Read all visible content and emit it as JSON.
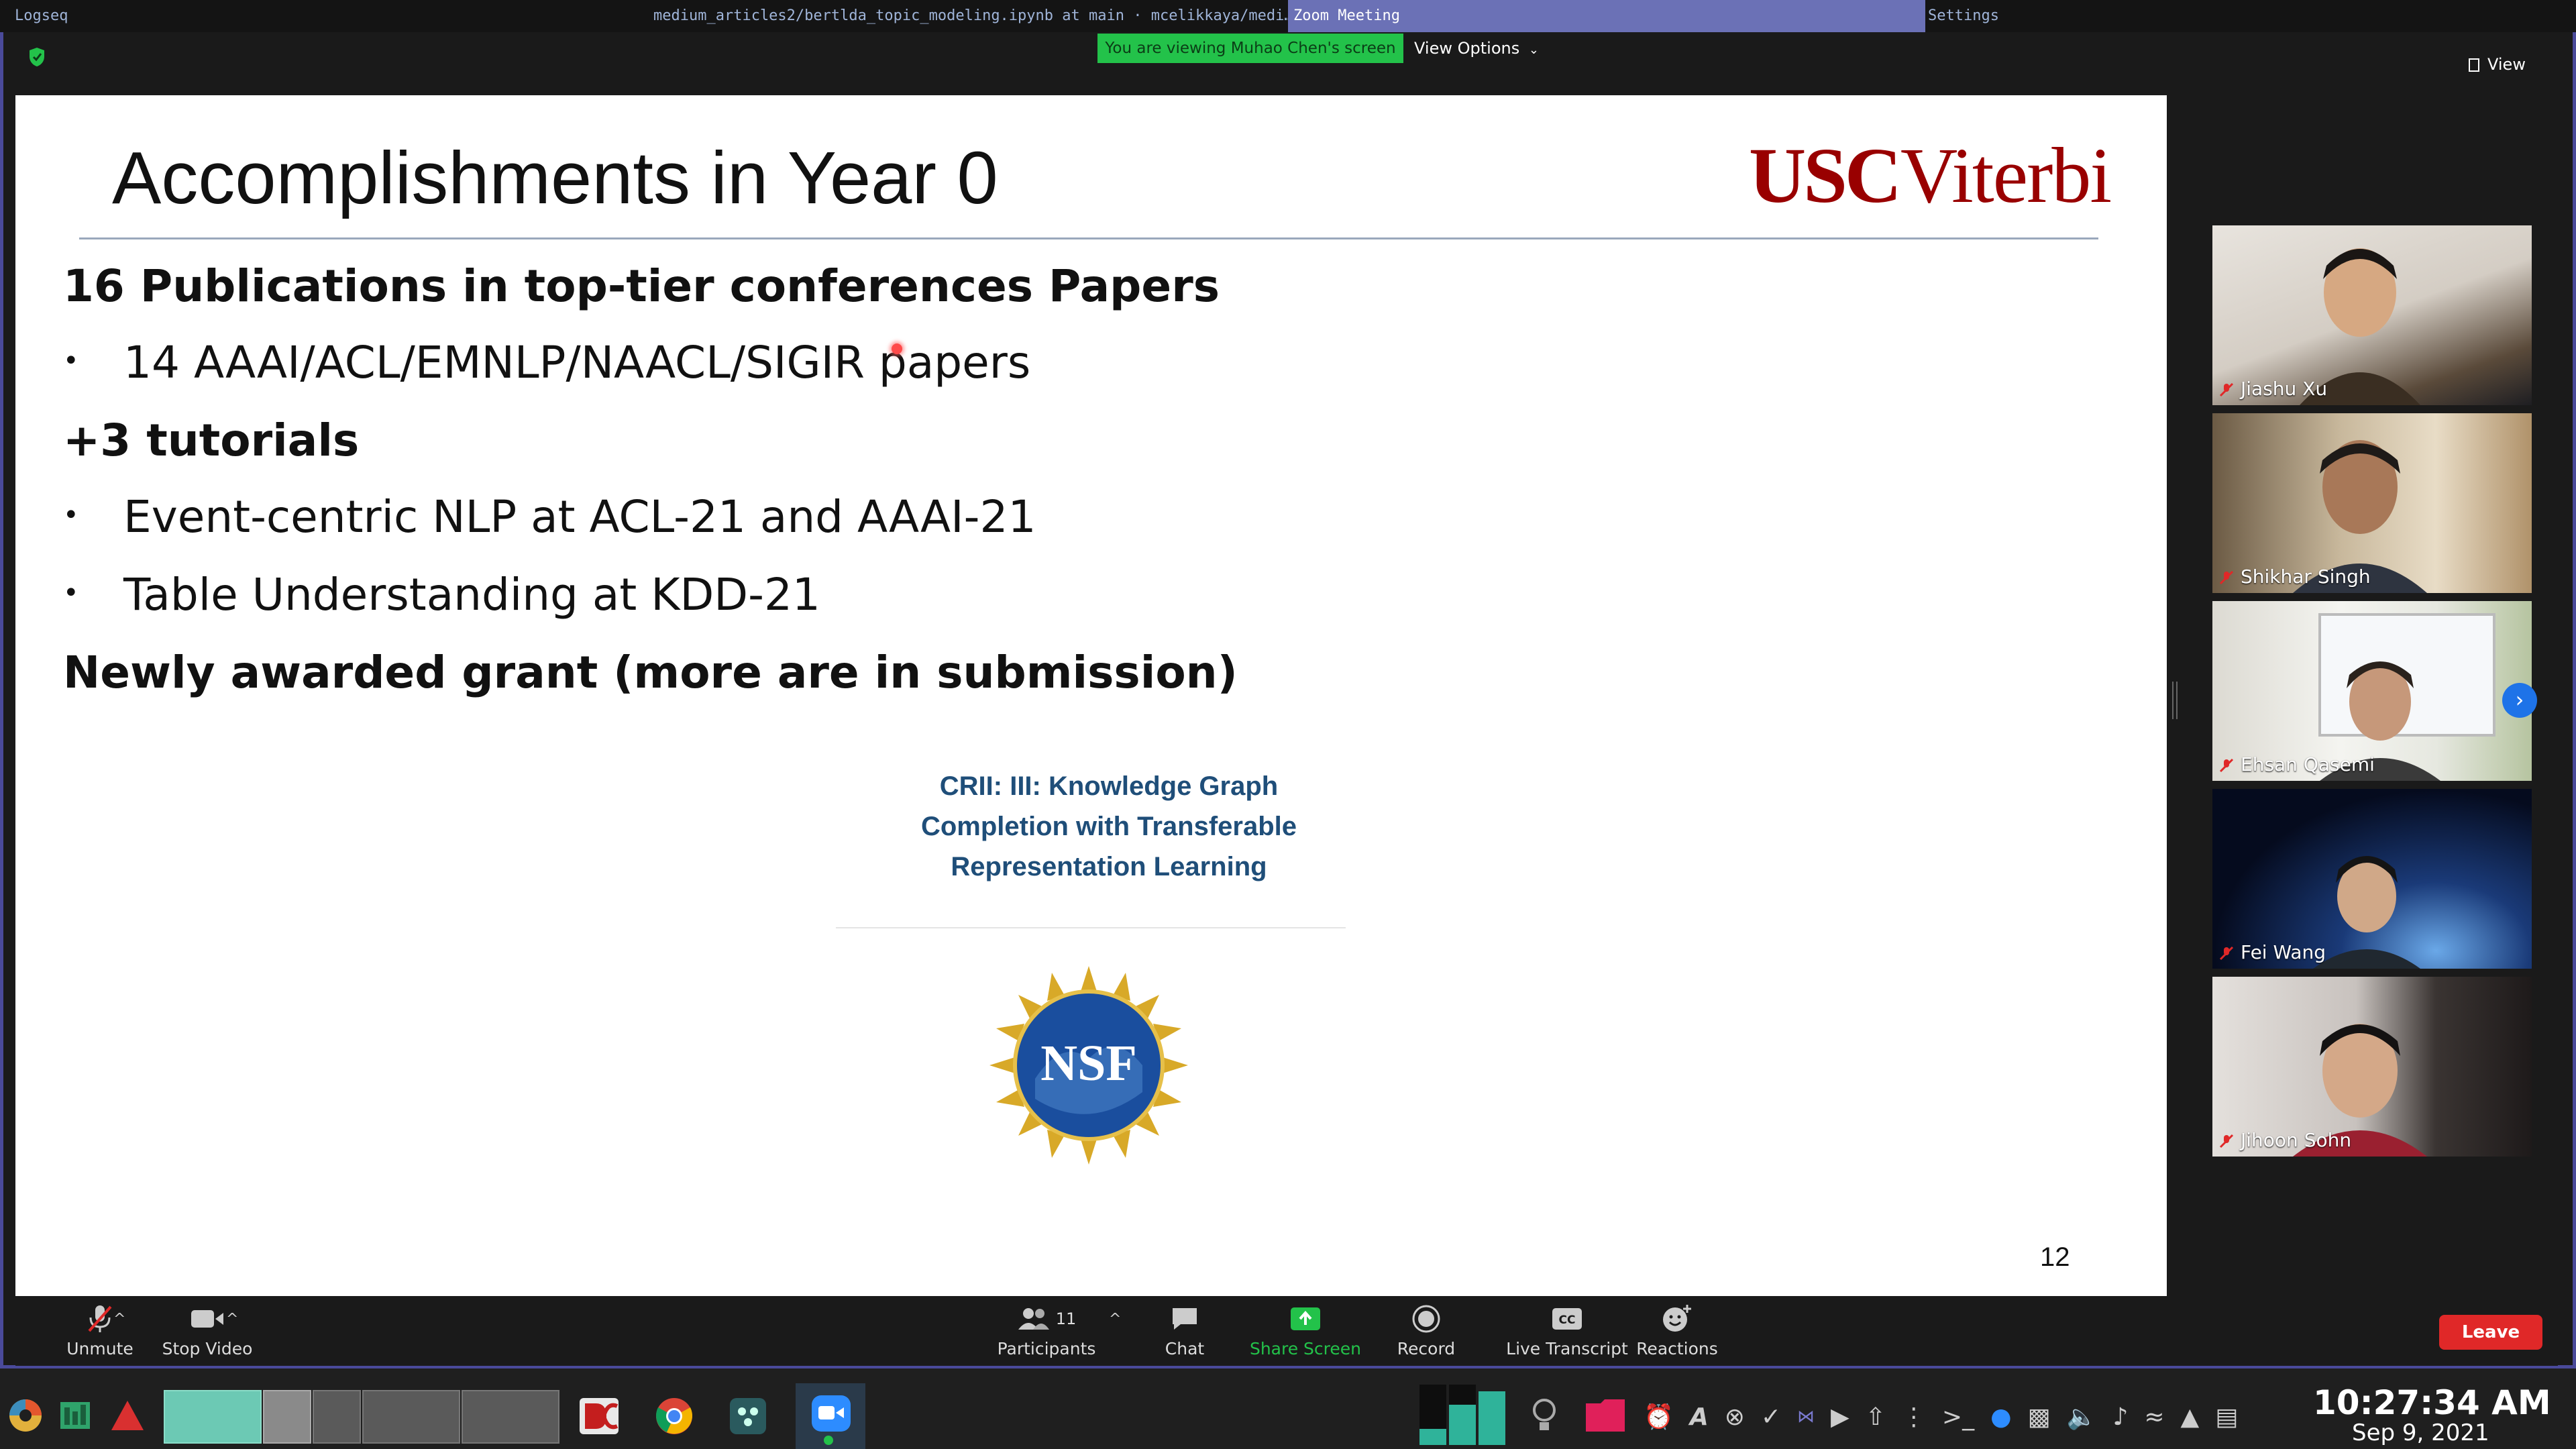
{
  "titlebar": {
    "items": [
      "Logseq",
      "medium_articles2/bertlda_topic_modeling.ipynb at main · mcelikkaya/medi…",
      "Zoom Meeting",
      "Settings"
    ]
  },
  "zoom": {
    "viewing_banner": "You are viewing Muhao Chen's screen",
    "view_options": "View Options",
    "view": "View"
  },
  "slide": {
    "title": "Accomplishments in Year 0",
    "logo_usc": "USC",
    "logo_viterbi": "Viterbi",
    "lines": [
      {
        "type": "heading",
        "text": "16 Publications in top-tier conferences Papers"
      },
      {
        "type": "bullet",
        "text": "14 AAAI/ACL/EMNLP/NAACL/SIGIR papers"
      },
      {
        "type": "heading",
        "text": "+3 tutorials"
      },
      {
        "type": "bullet",
        "text": "Event-centric NLP at ACL-21 and AAAI-21"
      },
      {
        "type": "bullet",
        "text": "Table Understanding at KDD-21"
      },
      {
        "type": "heading",
        "text": "Newly awarded grant (more are in submission)"
      }
    ],
    "grant_lines": [
      "CRII: III: Knowledge Graph",
      "Completion with Transferable",
      "Representation Learning"
    ],
    "nsf_text": "NSF",
    "page_number": "12"
  },
  "participants": [
    {
      "name": "Jiashu Xu",
      "muted": true
    },
    {
      "name": "Shikhar Singh",
      "muted": true
    },
    {
      "name": "Ehsan Qasemi",
      "muted": true
    },
    {
      "name": "Fei Wang",
      "muted": true
    },
    {
      "name": "Jihoon Sohn",
      "muted": true
    }
  ],
  "controls": {
    "unmute": "Unmute",
    "stop_video": "Stop Video",
    "participants": "Participants",
    "participants_count": "11",
    "chat": "Chat",
    "share_screen": "Share Screen",
    "record": "Record",
    "live_transcript": "Live Transcript",
    "reactions": "Reactions",
    "leave": "Leave"
  },
  "taskbar": {
    "time": "10:27:34 AM",
    "date": "Sep 9, 2021"
  },
  "colors": {
    "share_green": "#23c24a",
    "leave_red": "#e02828",
    "usc_cardinal": "#990000",
    "grant_blue": "#1f4e79",
    "zoom_blue": "#1e73e8"
  }
}
